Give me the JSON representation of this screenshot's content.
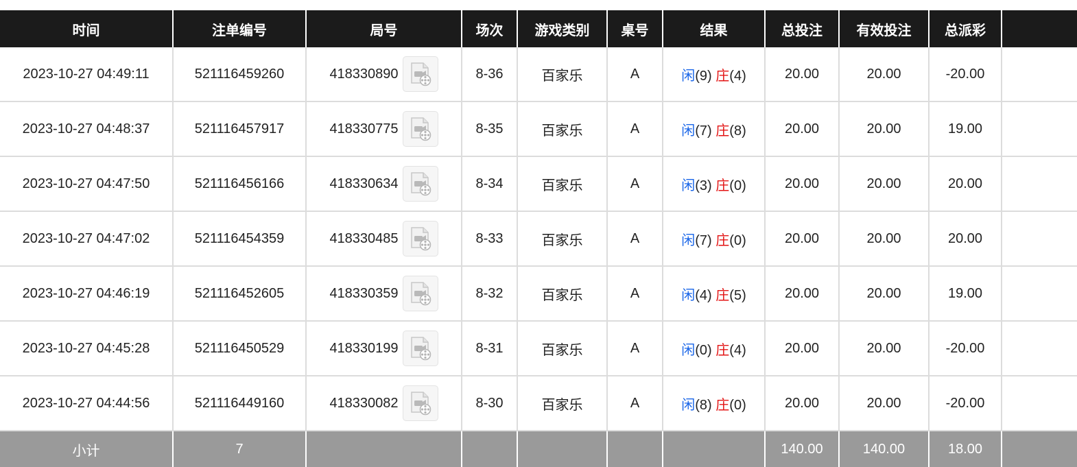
{
  "columns": [
    "时间",
    "注单编号",
    "局号",
    "场次",
    "游戏类别",
    "桌号",
    "结果",
    "总投注",
    "有效投注",
    "总派彩",
    ""
  ],
  "rows": [
    {
      "time": "2023-10-27 04:49:11",
      "bet_id": "521116459260",
      "round": "418330890",
      "shoe": "8-36",
      "game": "百家乐",
      "table": "A",
      "player_label": "闲",
      "player_score": "(9)",
      "banker_label": "庄",
      "banker_score": "(4)",
      "total_bet": "20.00",
      "valid_bet": "20.00",
      "payout": "-20.00",
      "payout_negative": true
    },
    {
      "time": "2023-10-27 04:48:37",
      "bet_id": "521116457917",
      "round": "418330775",
      "shoe": "8-35",
      "game": "百家乐",
      "table": "A",
      "player_label": "闲",
      "player_score": "(7)",
      "banker_label": "庄",
      "banker_score": "(8)",
      "total_bet": "20.00",
      "valid_bet": "20.00",
      "payout": "19.00",
      "payout_negative": false
    },
    {
      "time": "2023-10-27 04:47:50",
      "bet_id": "521116456166",
      "round": "418330634",
      "shoe": "8-34",
      "game": "百家乐",
      "table": "A",
      "player_label": "闲",
      "player_score": "(3)",
      "banker_label": "庄",
      "banker_score": "(0)",
      "total_bet": "20.00",
      "valid_bet": "20.00",
      "payout": "20.00",
      "payout_negative": false
    },
    {
      "time": "2023-10-27 04:47:02",
      "bet_id": "521116454359",
      "round": "418330485",
      "shoe": "8-33",
      "game": "百家乐",
      "table": "A",
      "player_label": "闲",
      "player_score": "(7)",
      "banker_label": "庄",
      "banker_score": "(0)",
      "total_bet": "20.00",
      "valid_bet": "20.00",
      "payout": "20.00",
      "payout_negative": false
    },
    {
      "time": "2023-10-27 04:46:19",
      "bet_id": "521116452605",
      "round": "418330359",
      "shoe": "8-32",
      "game": "百家乐",
      "table": "A",
      "player_label": "闲",
      "player_score": "(4)",
      "banker_label": "庄",
      "banker_score": "(5)",
      "total_bet": "20.00",
      "valid_bet": "20.00",
      "payout": "19.00",
      "payout_negative": false
    },
    {
      "time": "2023-10-27 04:45:28",
      "bet_id": "521116450529",
      "round": "418330199",
      "shoe": "8-31",
      "game": "百家乐",
      "table": "A",
      "player_label": "闲",
      "player_score": "(0)",
      "banker_label": "庄",
      "banker_score": "(4)",
      "total_bet": "20.00",
      "valid_bet": "20.00",
      "payout": "-20.00",
      "payout_negative": true
    },
    {
      "time": "2023-10-27 04:44:56",
      "bet_id": "521116449160",
      "round": "418330082",
      "shoe": "8-30",
      "game": "百家乐",
      "table": "A",
      "player_label": "闲",
      "player_score": "(8)",
      "banker_label": "庄",
      "banker_score": "(0)",
      "total_bet": "20.00",
      "valid_bet": "20.00",
      "payout": "-20.00",
      "payout_negative": true
    }
  ],
  "subtotal": {
    "label": "小计",
    "count": "7",
    "total_bet": "140.00",
    "valid_bet": "140.00",
    "payout": "18.00"
  },
  "icons": {
    "round_video": "video-replay-icon"
  },
  "colors": {
    "header_bg": "#1b1b1b",
    "subtotal_bg": "#9a9a9a",
    "blue": "#1a66e8",
    "red": "#e31414"
  }
}
